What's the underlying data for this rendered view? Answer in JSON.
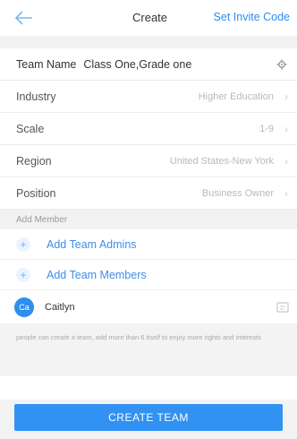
{
  "header": {
    "title": "Create",
    "action": "Set Invite Code"
  },
  "form": {
    "team_name_label": "Team Name",
    "team_name_value": "Class One,Grade one",
    "rows": [
      {
        "label": "Industry",
        "value": "Higher Education"
      },
      {
        "label": "Scale",
        "value": "1-9"
      },
      {
        "label": "Region",
        "value": "United States-New York"
      },
      {
        "label": "Position",
        "value": "Business Owner"
      }
    ]
  },
  "members": {
    "section_title": "Add Member",
    "add_admins": "Add Team Admins",
    "add_members": "Add Team Members",
    "list": [
      {
        "initials": "Ca",
        "name": "Caitlyn"
      }
    ]
  },
  "tip": "people can create a team, add more than 6 itself to enjoy more rights and interests",
  "footer": {
    "create_label": "CREATE TEAM"
  },
  "colors": {
    "accent": "#3192f3",
    "background": "#f2f2f2"
  }
}
